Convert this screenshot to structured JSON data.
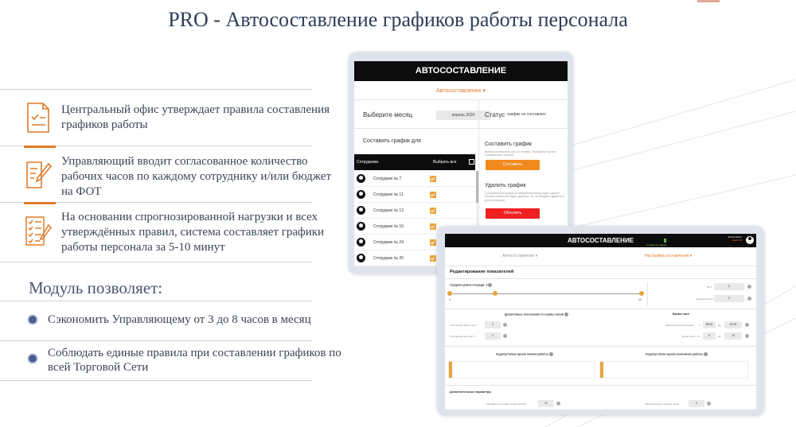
{
  "title": "PRO - Автосоставление графиков работы персонала",
  "features": [
    {
      "icon": "document-check-icon",
      "text": "Центральный  офис утверждает правила составления  графиков работы"
    },
    {
      "icon": "pen-document-icon",
      "text": "Управляющий вводит согласованное  количество рабочих часов по каждому сотруднику и/или бюджет на ФОТ"
    },
    {
      "icon": "checklist-icon",
      "text": "На основании  спрогнозированной нагрузки и всех утверждённых правил, система составляет графики работы персонала  за 5-10 минут"
    }
  ],
  "module_title": "Модуль позволяет:",
  "benefits": [
    "Сэкономить Управляющему от 3 до 8 часов в месяц",
    "Соблюдать единые правила при составлении  графиков по всей Торговой Сети"
  ],
  "back_screen": {
    "app_title": "АВТОСОСТАВЛЕНИЕ",
    "dropdown": "Автосоставление ▾",
    "month_label": "Выберите месяц",
    "month_value": "апрель 2020",
    "status_label": "Статус",
    "status_value": "график не составлен",
    "make_for_label": "Составить график для",
    "col_employees": "Сотрудники",
    "col_select_all": "Выбрать все",
    "employees": [
      "Сотрудник № 7",
      "Сотрудник № 11",
      "Сотрудник № 13",
      "Сотрудник № 16",
      "Сотрудник № 24",
      "Сотрудник № 26"
    ],
    "compose_title": "Составить график",
    "compose_desc": "Время составления для 10 человек. Примерное время составления 1 минута.",
    "compose_button": "Составить",
    "delete_title": "Удалить график",
    "delete_desc": "Составленный график за выбранный месяц будет удален. Ручные изменения будут удалены. Их необходимо удалить в ручном режиме.",
    "delete_button": "Обнулить",
    "colors": {
      "accent": "#e07b2b",
      "checkbox": "#e9a43d",
      "compose": "#f08a1c",
      "delete": "#ee2020"
    }
  },
  "front_screen": {
    "app_title": "АВТОСОСТАВЛЕНИЕ",
    "status_text": "● зашёл не зашёл",
    "admin_name": "Admin Admin",
    "admin_role": "Заказ 10",
    "tab_auto": "Автосоставление ▾",
    "tab_settings": "Настройка составления ▾",
    "section_title": "Редактирование показателей",
    "avg_queue_label": "Средняя длина очереди: 3",
    "slider_min": "1",
    "slider_max": "10",
    "fot_label": "ФОТ",
    "fot_value": "0",
    "overtime_label": "Переработка %",
    "overtime_value": "0",
    "deviation_title": "Допустимые отклонения от нормы часов",
    "deviation_plus_label": "Отклонение вверх на %",
    "deviation_plus_value": "3",
    "deviation_minus_label": "Отклонение вниз на %",
    "deviation_minus_value": "3",
    "shift_time_title": "Время смен",
    "shift_start_label": "Начало работы магазина",
    "shift_from_label": "С",
    "shift_from_value": "08:00",
    "shift_to_label": "До",
    "shift_to_value": "22:00",
    "shift_length_label": "Длина смен",
    "shift_len_from_label": "От",
    "shift_len_from_value": "6",
    "shift_len_to_label": "До",
    "shift_len_to_value": "15",
    "bad_start_title": "Недопустимое время начала работы",
    "bad_end_title": "Недопустимое время окончания работы",
    "extra_title": "Дополнительные параметры",
    "extra_min_label": "Минимальное время перед сменой",
    "extra_min_value": "12",
    "extra_max_label": "Максимальное в подряд часов",
    "extra_max_value": "0"
  }
}
